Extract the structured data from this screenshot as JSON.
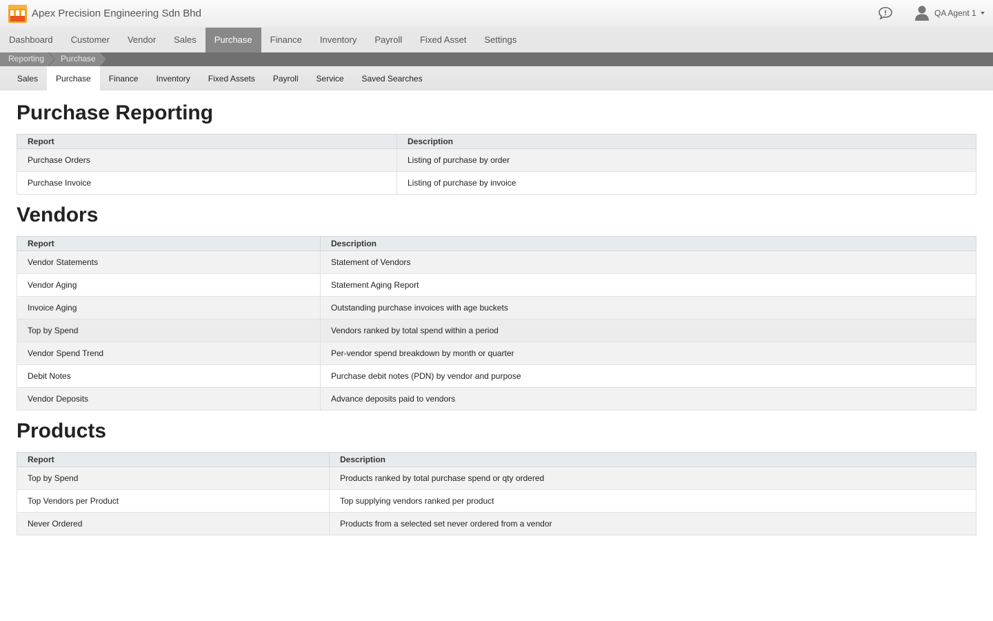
{
  "header": {
    "company_name": "Apex Precision Engineering Sdn Bhd",
    "user_name": "QA Agent 1",
    "logo_colors": [
      "#f5a11b",
      "#e8551e"
    ]
  },
  "main_nav": {
    "items": [
      {
        "label": "Dashboard"
      },
      {
        "label": "Customer"
      },
      {
        "label": "Vendor"
      },
      {
        "label": "Sales"
      },
      {
        "label": "Purchase",
        "active": true
      },
      {
        "label": "Finance"
      },
      {
        "label": "Inventory"
      },
      {
        "label": "Payroll"
      },
      {
        "label": "Fixed Asset"
      },
      {
        "label": "Settings"
      }
    ]
  },
  "breadcrumb": [
    "Reporting",
    "Purchase"
  ],
  "sub_nav": {
    "items": [
      {
        "label": "Sales"
      },
      {
        "label": "Purchase",
        "active": true
      },
      {
        "label": "Finance"
      },
      {
        "label": "Inventory"
      },
      {
        "label": "Fixed Assets"
      },
      {
        "label": "Payroll"
      },
      {
        "label": "Service"
      },
      {
        "label": "Saved Searches"
      }
    ]
  },
  "sections": [
    {
      "title": "Purchase Reporting",
      "col_report": "Report",
      "col_description": "Description",
      "rows": [
        {
          "report": "Purchase Orders",
          "description": "Listing of purchase by order"
        },
        {
          "report": "Purchase Invoice",
          "description": "Listing of purchase by invoice"
        }
      ]
    },
    {
      "title": "Vendors",
      "col_report": "Report",
      "col_description": "Description",
      "rows": [
        {
          "report": "Vendor Statements",
          "description": "Statement of Vendors"
        },
        {
          "report": "Vendor Aging",
          "description": "Statement Aging Report"
        },
        {
          "report": "Invoice Aging",
          "description": "Outstanding purchase invoices with age buckets"
        },
        {
          "report": "Top by Spend",
          "description": "Vendors ranked by total spend within a period"
        },
        {
          "report": "Vendor Spend Trend",
          "description": "Per-vendor spend breakdown by month or quarter"
        },
        {
          "report": "Debit Notes",
          "description": "Purchase debit notes (PDN) by vendor and purpose"
        },
        {
          "report": "Vendor Deposits",
          "description": "Advance deposits paid to vendors"
        }
      ]
    },
    {
      "title": "Products",
      "col_report": "Report",
      "col_description": "Description",
      "rows": [
        {
          "report": "Top by Spend",
          "description": "Products ranked by total purchase spend or qty ordered"
        },
        {
          "report": "Top Vendors per Product",
          "description": "Top supplying vendors ranked per product"
        },
        {
          "report": "Never Ordered",
          "description": "Products from a selected set never ordered from a vendor"
        }
      ]
    }
  ]
}
